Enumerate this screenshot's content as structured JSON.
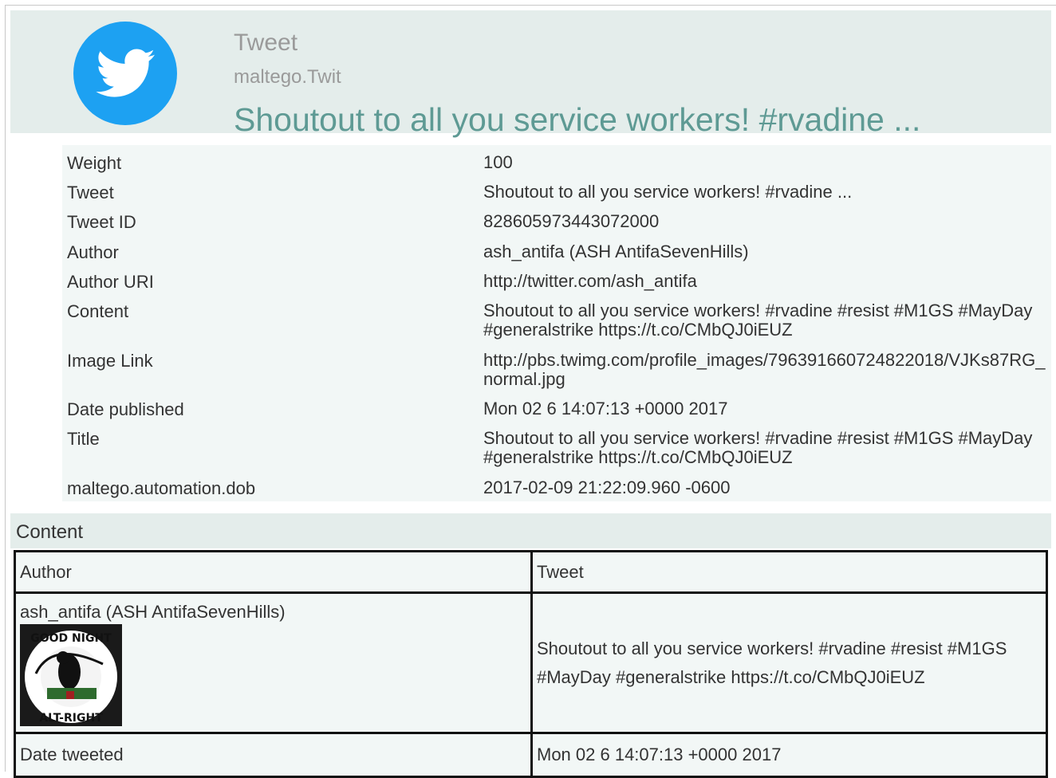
{
  "header": {
    "entity_type": "Tweet",
    "entity_class": "maltego.Twit",
    "entity_value": "Shoutout to all you service workers! #rvadine ...",
    "logo_icon": "twitter-bird-icon",
    "logo_color": "#1da1f2"
  },
  "properties": [
    {
      "key": "Weight",
      "value": "100"
    },
    {
      "key": "Tweet",
      "value": "Shoutout to all you service workers! #rvadine ..."
    },
    {
      "key": "Tweet ID",
      "value": "828605973443072000"
    },
    {
      "key": "Author",
      "value": "ash_antifa (ASH AntifaSevenHills)"
    },
    {
      "key": "Author URI",
      "value": "http://twitter.com/ash_antifa"
    },
    {
      "key": "Content",
      "value": "Shoutout to all you service workers! #rvadine  #resist #M1GS #MayDay #generalstrike https://t.co/CMbQJ0iEUZ"
    },
    {
      "key": "Image Link",
      "value": "http://pbs.twimg.com/profile_images/796391660724822018/VJKs87RG_normal.jpg"
    },
    {
      "key": "Date published",
      "value": "Mon 02 6 14:07:13 +0000 2017"
    },
    {
      "key": "Title",
      "value": "Shoutout to all you service workers! #rvadine  #resist #M1GS #MayDay #generalstrike https://t.co/CMbQJ0iEUZ"
    },
    {
      "key": "maltego.automation.dob",
      "value": "2017-02-09 21:22:09.960 -0600"
    }
  ],
  "content_section": {
    "title": "Content",
    "col_author": "Author",
    "col_tweet": "Tweet",
    "author": "ash_antifa (ASH AntifaSevenHills)",
    "avatar_text_top": "GOOD NIGHT",
    "avatar_text_bottom": "ALT-RIGHT",
    "tweet": "Shoutout to all you service workers! #rvadine #resist #M1GS #MayDay #generalstrike https://t.co/CMbQJ0iEUZ",
    "date_label": "Date tweeted",
    "date_value": "Mon 02 6 14:07:13 +0000 2017"
  }
}
